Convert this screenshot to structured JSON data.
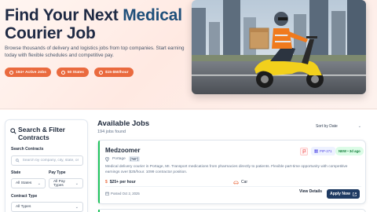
{
  "hero": {
    "title_main": "Find Your Next ",
    "title_accent": "Medical",
    "title_line2": "Courier Job",
    "subtitle": "Browse thousands of delivery and logistics jobs from top companies. Start earning today with flexible schedules and competitive pay.",
    "pills": [
      {
        "label": "194+ Active Jobs",
        "icon": "briefcase-icon"
      },
      {
        "label": "50 States",
        "icon": "map-pin-icon"
      },
      {
        "label": "$15-$50/hour",
        "icon": "dollar-icon"
      }
    ],
    "image_alt": "Courier riding a yellow scooter with delivery box in city"
  },
  "filters": {
    "title": "Search & Filter Contracts",
    "search_label": "Search Contracts",
    "search_placeholder": "Search by company, city, state, or tit",
    "state_label": "State",
    "state_value": "All States",
    "paytype_label": "Pay Type",
    "paytype_value": "All Pay Types",
    "contract_label": "Contract Type",
    "contract_value": "All Types"
  },
  "jobs": {
    "title": "Available Jobs",
    "count": "194 jobs found",
    "sort_value": "Sort by Date"
  },
  "job_card": {
    "company": "Medzoomer",
    "location": "Portage",
    "location_tag": "[\"MI\"]",
    "description": "Medical delivery courier in Portage, MI. Transport medications from pharmacies directly to patients. Flexible part-time opportunity with competitive earnings over $25/hour. 1099 contractor position.",
    "pay": "$25+ per hour",
    "vehicle": "Car",
    "posted": "Posted Oct 2, 2025",
    "pin_badge": "PIP-271",
    "new_badge": "NEW • 3d ago",
    "view_label": "View Details",
    "apply_label": "Apply Now"
  },
  "colors": {
    "accent_orange": "#ea6a3e",
    "navy": "#1f3b63",
    "green": "#22c55e"
  }
}
